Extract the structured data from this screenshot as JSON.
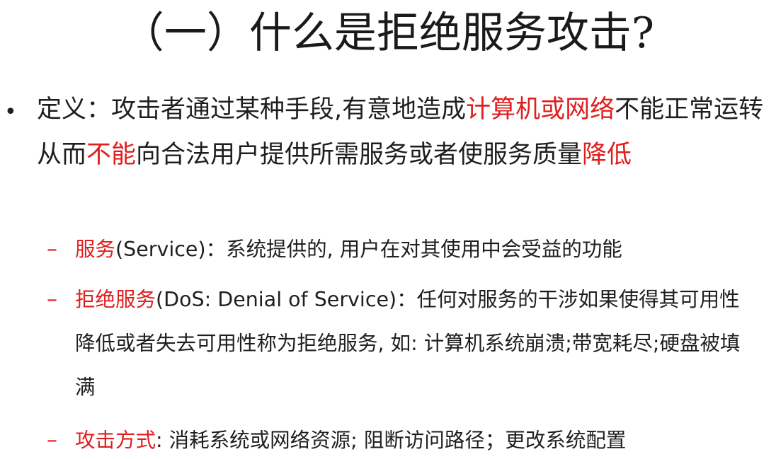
{
  "title": "（一）什么是拒绝服务攻击?",
  "bullet": {
    "marker": "•",
    "segments": [
      {
        "text": "定义：攻击者通过某种手段,有意地造成",
        "red": false
      },
      {
        "text": "计算机或网络",
        "red": true
      },
      {
        "text": "不能正常运转从而",
        "red": false
      },
      {
        "text": "不能",
        "red": true
      },
      {
        "text": "向合法用户提供所需服务或者使服务质量",
        "red": false
      },
      {
        "text": "降低",
        "red": true
      }
    ]
  },
  "sub_items": [
    {
      "marker": "–",
      "term": "服务",
      "rest": "(Service)：系统提供的, 用户在对其使用中会受益的功能"
    },
    {
      "marker": "–",
      "term": "拒绝服务",
      "rest": "(DoS: Denial of Service)：任何对服务的干涉如果使得其可用性降低或者失去可用性称为拒绝服务, 如: 计算机系统崩溃;带宽耗尽;硬盘被填满"
    },
    {
      "marker": "–",
      "term": "攻击方式",
      "rest": ": 消耗系统或网络资源; 阻断访问路径；更改系统配置"
    }
  ],
  "colors": {
    "text": "#1f1f1f",
    "accent": "#e01e1e",
    "background": "#ffffff"
  }
}
